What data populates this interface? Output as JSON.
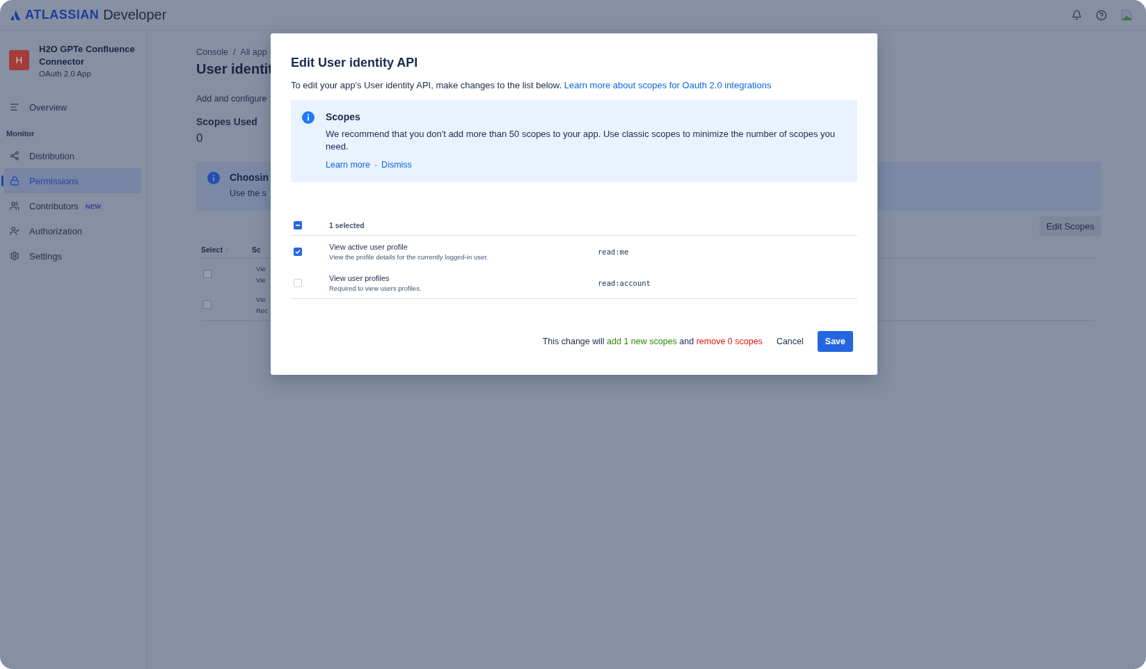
{
  "top_bar": {
    "brand": "ATLASSIAN",
    "product": "Developer"
  },
  "sidebar": {
    "app": {
      "initial": "H",
      "name": "H2O GPTe Confluence Connector",
      "type": "OAuth 2.0 App"
    },
    "items": [
      {
        "kind": "link",
        "label": "Overview",
        "selected": false
      },
      {
        "kind": "heading",
        "label": "Monitor"
      },
      {
        "kind": "link",
        "label": "Distribution",
        "selected": false
      },
      {
        "kind": "link",
        "label": "Permissions",
        "selected": true
      },
      {
        "kind": "link",
        "label": "Contributors",
        "badge": "NEW",
        "selected": false
      },
      {
        "kind": "link",
        "label": "Authorization",
        "selected": false
      },
      {
        "kind": "link",
        "label": "Settings",
        "selected": false
      }
    ]
  },
  "main": {
    "breadcrumb": [
      "Console",
      "All app"
    ],
    "breadcrumb_separator": "/",
    "title": "User identit",
    "description": "Add and configure",
    "stat": {
      "label": "Scopes Used",
      "value": "0"
    },
    "notice": {
      "title": "Choosin",
      "text": "Use the s"
    },
    "edit_button": "Edit Scopes",
    "table": {
      "columns": [
        "Select",
        "Sc"
      ],
      "rows": [
        {
          "checked": false,
          "title": "Vie",
          "subtitle": "Vie"
        },
        {
          "checked": false,
          "title": "Vie",
          "subtitle": "Rec"
        }
      ]
    }
  },
  "modal": {
    "title": "Edit User identity API",
    "description": "To edit your app's User identity API, make changes to the list below.",
    "link": "Learn more about scopes for Oauth 2.0 integrations",
    "notice": {
      "title": "Scopes",
      "text": "We recommend that you don't add more than 50 scopes to your app. Use classic scopes to minimize the number of scopes you need.",
      "actions": [
        "Learn more",
        "Dismiss"
      ],
      "separator": "·"
    },
    "header_checkbox": {
      "indeterminate": true
    },
    "selected_count": "1 selected",
    "rows": [
      {
        "checked": true,
        "title": "View active user profile",
        "description": "View the profile details for the currently logged-in user.",
        "scope": "read:me"
      },
      {
        "checked": false,
        "title": "View user profiles",
        "description": "Required to view users profiles.",
        "scope": "read:account"
      }
    ],
    "summary": {
      "prefix": "This change will",
      "added": "add 1 new scopes",
      "joiner": "and",
      "removed": "remove 0 scopes"
    },
    "cancel": "Cancel",
    "save": "Save"
  }
}
